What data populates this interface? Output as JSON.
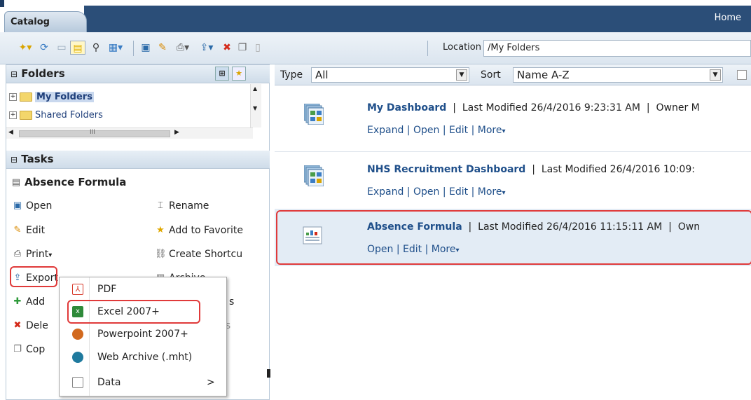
{
  "top": {
    "tab_label": "Catalog",
    "home_link": "Home"
  },
  "toolbar": {
    "location_label": "Location",
    "location_value": "/My Folders"
  },
  "folders": {
    "title": "Folders",
    "items": [
      {
        "label": "My Folders",
        "selected": true
      },
      {
        "label": "Shared Folders",
        "selected": false
      }
    ],
    "scroll_mark": "III"
  },
  "tasks": {
    "title": "Tasks",
    "item_name": "Absence Formula",
    "left": [
      {
        "label": "Open",
        "icon": "open-icon"
      },
      {
        "label": "Edit",
        "icon": "pencil-icon"
      },
      {
        "label": "Print",
        "icon": "printer-icon"
      },
      {
        "label": "Export",
        "icon": "export-icon"
      },
      {
        "label": "Add",
        "icon": "add-icon"
      },
      {
        "label": "Dele",
        "icon": "delete-icon"
      },
      {
        "label": "Cop",
        "icon": "copy-icon"
      }
    ],
    "right": [
      {
        "label": "Rename",
        "icon": "rename-icon"
      },
      {
        "label": "Add to Favorite",
        "icon": "favorite-icon"
      },
      {
        "label": "Create Shortcu",
        "icon": "shortcut-icon"
      },
      {
        "label": "Archive",
        "icon": "archive-icon"
      },
      {
        "label": "s",
        "icon": ""
      },
      {
        "label": "ns",
        "icon": ""
      }
    ]
  },
  "export_menu": {
    "items": [
      {
        "label": "PDF",
        "icon": "pdf-icon",
        "color": "#d73a2a"
      },
      {
        "label": "Excel 2007+",
        "icon": "excel-icon",
        "color": "#2e8a3a",
        "highlighted": true
      },
      {
        "label": "Powerpoint 2007+",
        "icon": "powerpoint-icon",
        "color": "#d2691e"
      },
      {
        "label": "Web Archive (.mht)",
        "icon": "web-archive-icon",
        "color": "#1f7a9e"
      },
      {
        "label": "Data",
        "icon": "data-icon",
        "color": "#ffffff",
        "arrow": ">"
      }
    ]
  },
  "filter": {
    "type_label": "Type",
    "type_value": "All",
    "sort_label": "Sort",
    "sort_value": "Name A-Z"
  },
  "catalog_items": [
    {
      "name": "My Dashboard",
      "meta": "Last Modified 26/4/2016 9:23:31 AM",
      "owner": "Owner M",
      "links": [
        "Expand",
        "Open",
        "Edit",
        "More"
      ],
      "icon": "dashboard-icon"
    },
    {
      "name": "NHS Recruitment Dashboard",
      "meta": "Last Modified 26/4/2016 10:09:",
      "owner": "",
      "links": [
        "Expand",
        "Open",
        "Edit",
        "More"
      ],
      "icon": "dashboard-icon"
    },
    {
      "name": "Absence Formula",
      "meta": "Last Modified 26/4/2016 11:15:11 AM",
      "owner": "Own",
      "links": [
        "Open",
        "Edit",
        "More"
      ],
      "icon": "analysis-icon",
      "highlighted": true
    }
  ],
  "colors": {
    "header_blue": "#2b4e78",
    "link_blue": "#1f4f8a",
    "highlight_red": "#e03a3a"
  }
}
